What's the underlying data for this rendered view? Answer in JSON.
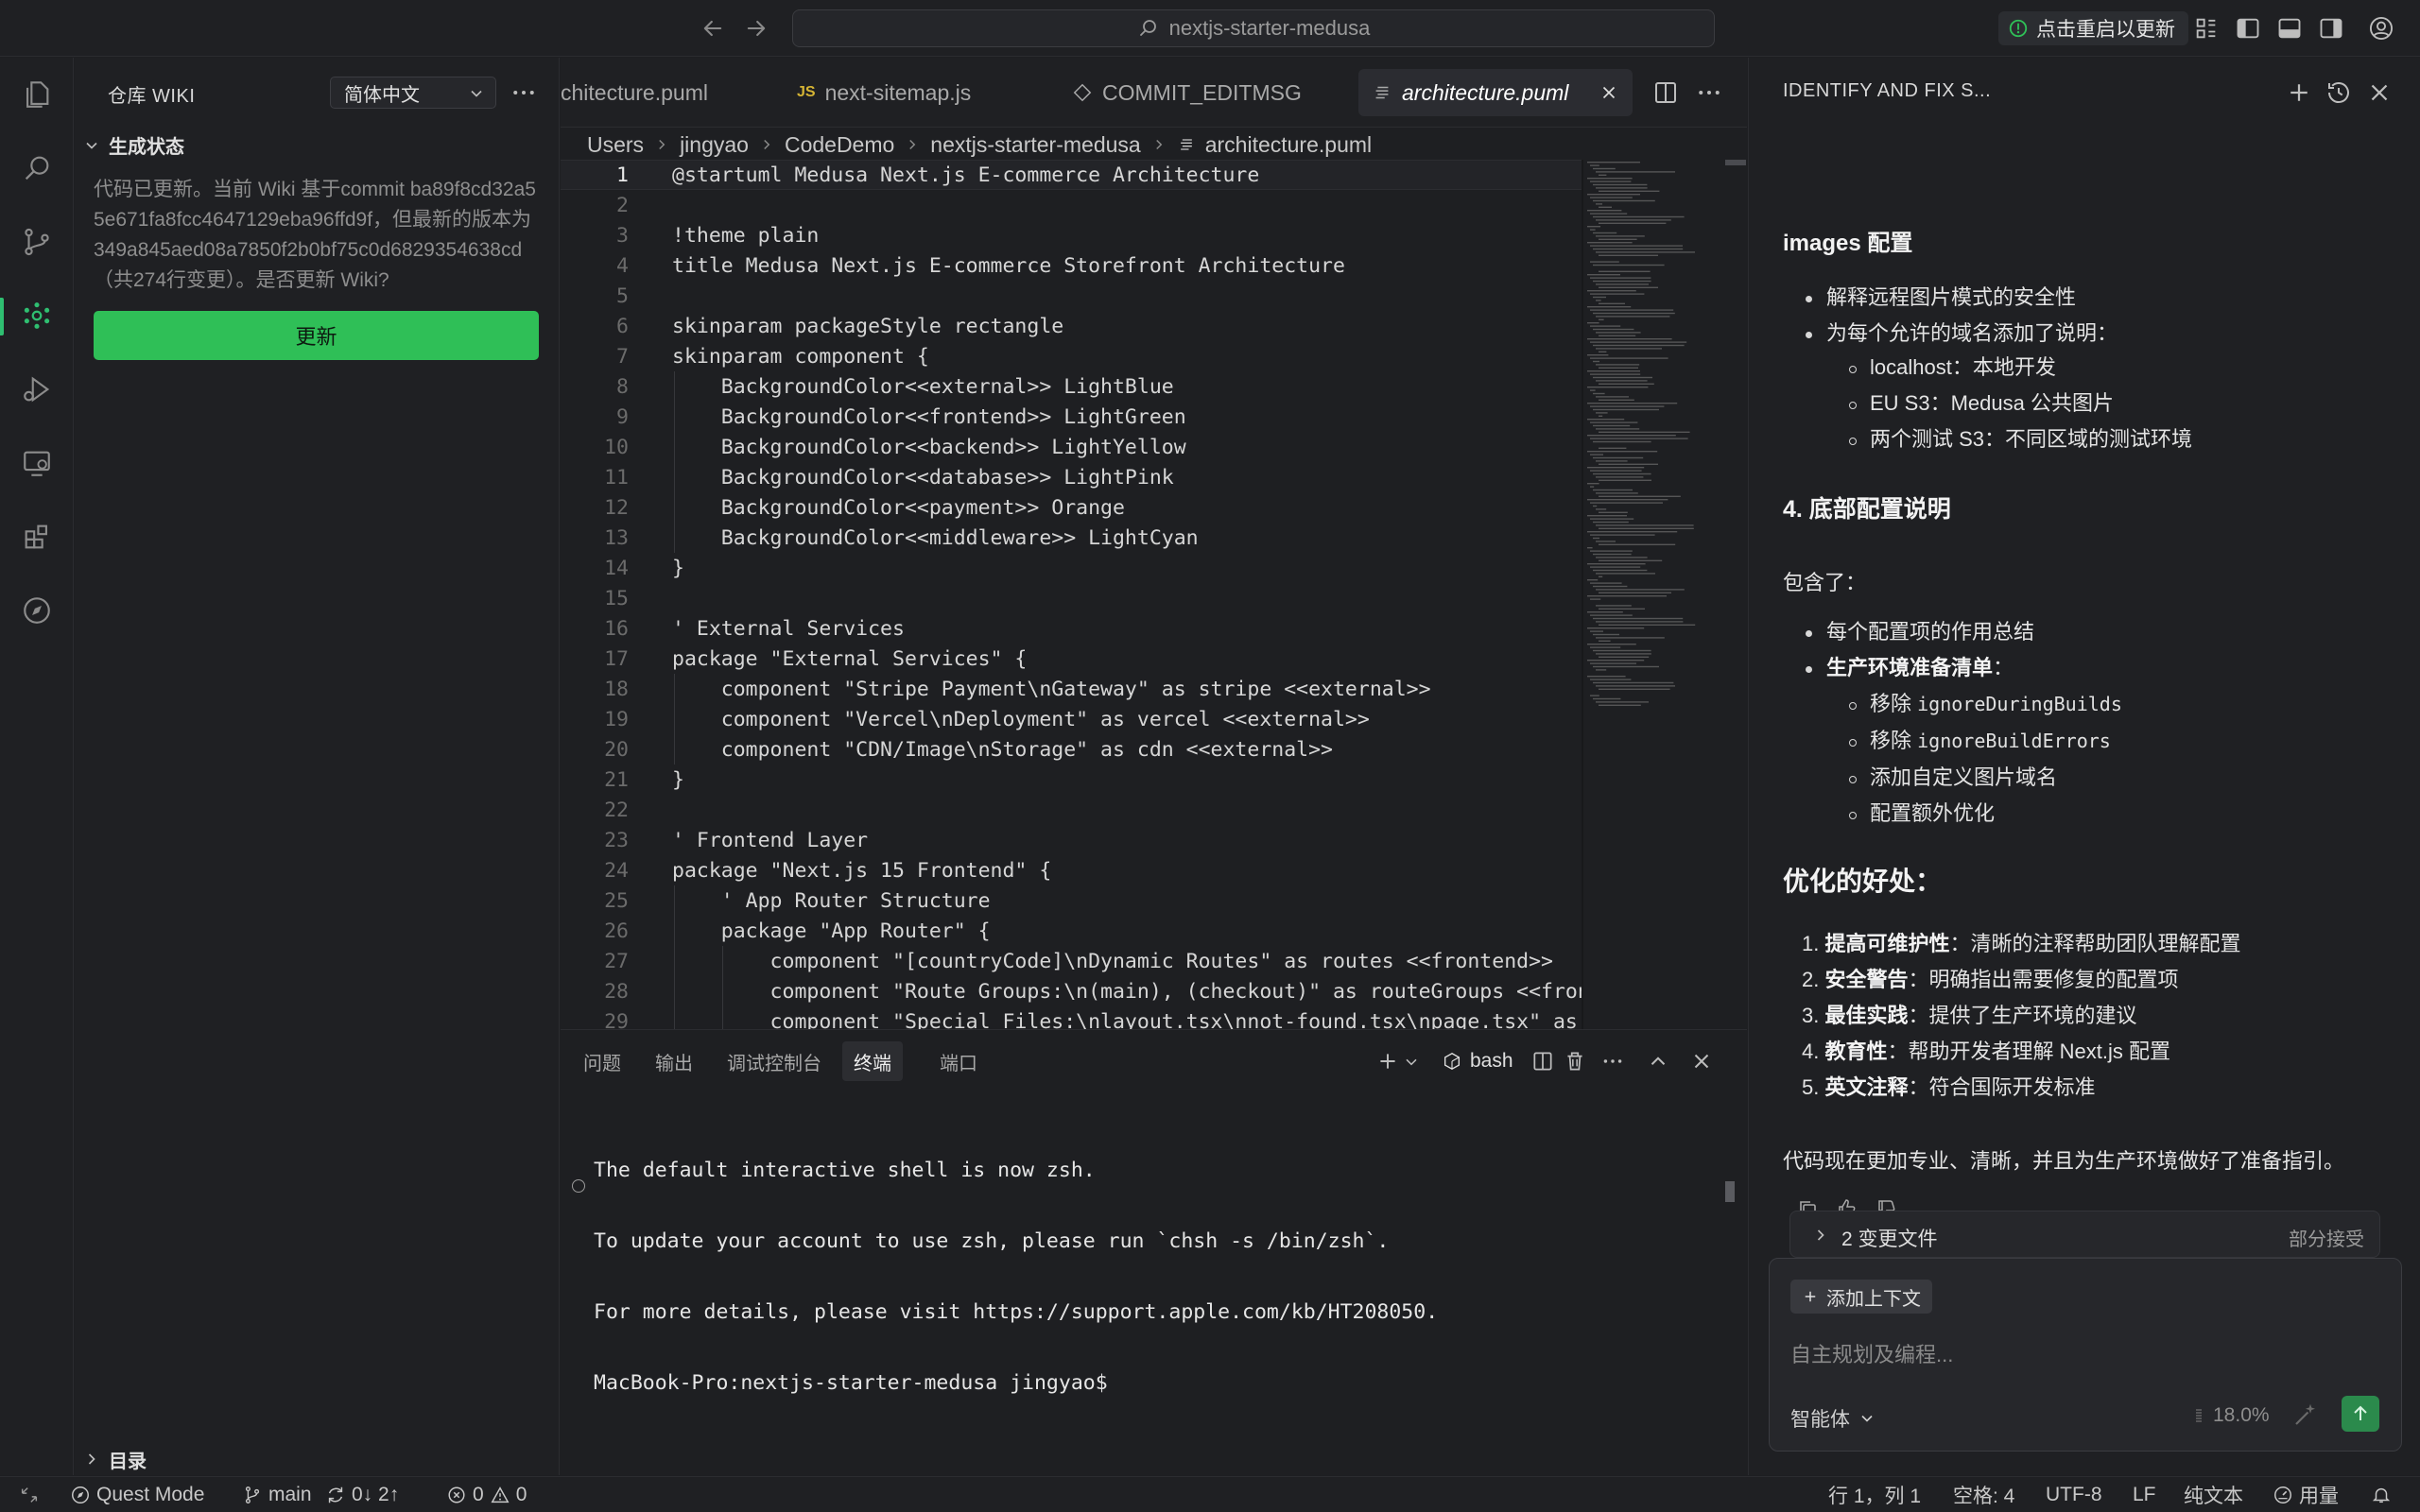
{
  "titlebar": {
    "search_text": "nextjs-starter-medusa",
    "update_restart_label": "点击重启以更新"
  },
  "sidebar": {
    "header": "仓库 WIKI",
    "language": "简体中文",
    "section_label": "生成状态",
    "message": "代码已更新。当前 Wiki 基于commit ba89f8cd32a55e671fa8fcc4647129eba96ffd9f，但最新的版本为349a845aed08a7850f2b0bf75c0d6829354638cd（共274行变更）。是否更新 Wiki?",
    "update_button": "更新",
    "toc_label": "目录"
  },
  "editor": {
    "tabs": [
      {
        "label": "chitecture.puml",
        "icon": "none"
      },
      {
        "label": "next-sitemap.js",
        "icon": "js-icon"
      },
      {
        "label": "COMMIT_EDITMSG",
        "icon": "git-diamond-icon"
      },
      {
        "label": "architecture.puml",
        "icon": "lines-icon",
        "active": true
      }
    ],
    "breadcrumb": [
      "Users",
      "jingyao",
      "CodeDemo",
      "nextjs-starter-medusa",
      "architecture.puml"
    ],
    "lines": [
      "@startuml Medusa Next.js E-commerce Architecture",
      "",
      "!theme plain",
      "title Medusa Next.js E-commerce Storefront Architecture",
      "",
      "skinparam packageStyle rectangle",
      "skinparam component {",
      "    BackgroundColor<<external>> LightBlue",
      "    BackgroundColor<<frontend>> LightGreen",
      "    BackgroundColor<<backend>> LightYellow",
      "    BackgroundColor<<database>> LightPink",
      "    BackgroundColor<<payment>> Orange",
      "    BackgroundColor<<middleware>> LightCyan",
      "}",
      "",
      "' External Services",
      "package \"External Services\" {",
      "    component \"Stripe Payment\\nGateway\" as stripe <<external>>",
      "    component \"Vercel\\nDeployment\" as vercel <<external>>",
      "    component \"CDN/Image\\nStorage\" as cdn <<external>>",
      "}",
      "",
      "' Frontend Layer",
      "package \"Next.js 15 Frontend\" {",
      "    ' App Router Structure",
      "    package \"App Router\" {",
      "        component \"[countryCode]\\nDynamic Routes\" as routes <<frontend>>",
      "        component \"Route Groups:\\n(main), (checkout)\" as routeGroups <<fron",
      "        component \"Special Files:\\nlayout.tsx\\nnot-found.tsx\\npage.tsx\" as"
    ]
  },
  "panel": {
    "tabs": [
      "问题",
      "输出",
      "调试控制台",
      "终端",
      "端口"
    ],
    "active_tab": "终端",
    "shell": "bash",
    "terminal_lines": [
      "The default interactive shell is now zsh.",
      "To update your account to use zsh, please run `chsh -s /bin/zsh`.",
      "For more details, please visit https://support.apple.com/kb/HT208050.",
      "MacBook-Pro:nextjs-starter-medusa jingyao$"
    ]
  },
  "chat": {
    "title": "IDENTIFY AND FIX S...",
    "images_heading_code": "images",
    "images_heading_rest": " 配置",
    "images_b1": "解释远程图片模式的安全性",
    "images_b2": "为每个允许的域名添加了说明：",
    "images_sub": [
      "localhost：本地开发",
      "EU S3：Medusa 公共图片",
      "两个测试 S3：不同区域的测试环境"
    ],
    "section4_heading": "4. 底部配置说明",
    "contains": "包含了：",
    "s4_b1": "每个配置项的作用总结",
    "s4_b2_bold": "生产环境准备清单",
    "s4_b2_rest": "：",
    "s4_sub": [
      {
        "pre": "移除 ",
        "code": "ignoreDuringBuilds"
      },
      {
        "pre": "移除 ",
        "code": "ignoreBuildErrors"
      },
      {
        "pre": "添加自定义图片域名",
        "code": ""
      },
      {
        "pre": "配置额外优化",
        "code": ""
      }
    ],
    "benefits_heading": "优化的好处：",
    "benefits": [
      {
        "num": "1.",
        "bold": "提高可维护性",
        "rest": "：清晰的注释帮助团队理解配置"
      },
      {
        "num": "2.",
        "bold": "安全警告",
        "rest": "：明确指出需要修复的配置项"
      },
      {
        "num": "3.",
        "bold": "最佳实践",
        "rest": "：提供了生产环境的建议"
      },
      {
        "num": "4.",
        "bold": "教育性",
        "rest": "：帮助开发者理解 Next.js 配置"
      },
      {
        "num": "5.",
        "bold": "英文注释",
        "rest": "：符合国际开发标准"
      }
    ],
    "conclusion": "代码现在更加专业、清晰，并且为生产环境做好了准备指引。",
    "changes_label": "2 变更文件",
    "changes_accept": "部分接受",
    "add_context": "添加上下文",
    "input_placeholder": "自主规划及编程...",
    "agent_label": "智能体",
    "context_percent": "18.0%"
  },
  "statusbar": {
    "mode": "Quest Mode",
    "branch": "main",
    "sync": "0↓ 2↑",
    "errors": "0",
    "warnings": "0",
    "cursor_pos": "行 1，列 1",
    "spaces": "空格: 4",
    "encoding": "UTF-8",
    "eol": "LF",
    "language": "纯文本",
    "usage": "用量"
  },
  "colors": {
    "accent_green": "#2fbf57",
    "background": "#1e1f22"
  }
}
